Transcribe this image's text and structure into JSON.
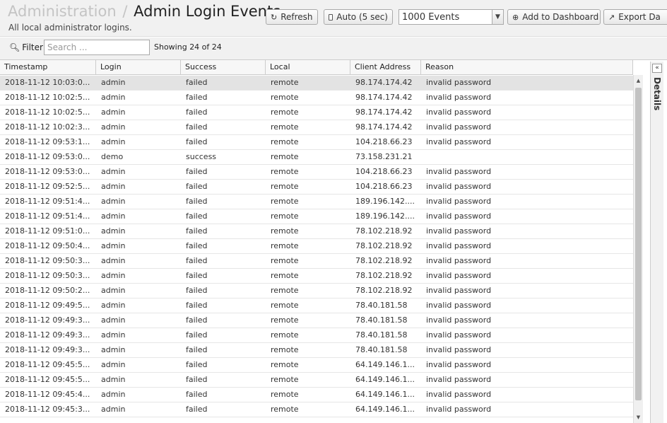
{
  "header": {
    "breadcrumb_parent": "Administration",
    "separator": "/",
    "title": "Admin Login Events",
    "subtitle": "All local administrator logins."
  },
  "toolbar": {
    "refresh_label": "Refresh",
    "auto_label": "Auto (5 sec)",
    "events_selected": "1000 Events",
    "add_dashboard_label": "Add to Dashboard",
    "export_label": "Export Da"
  },
  "filter": {
    "label": "Filter",
    "placeholder": "Search ...",
    "showing": "Showing 24 of 24"
  },
  "table": {
    "columns": [
      "Timestamp",
      "Login",
      "Success",
      "Local",
      "Client Address",
      "Reason"
    ],
    "rows": [
      [
        "2018-11-12 10:03:0...",
        "admin",
        "failed",
        "remote",
        "98.174.174.42",
        "invalid password"
      ],
      [
        "2018-11-12 10:02:5...",
        "admin",
        "failed",
        "remote",
        "98.174.174.42",
        "invalid password"
      ],
      [
        "2018-11-12 10:02:5...",
        "admin",
        "failed",
        "remote",
        "98.174.174.42",
        "invalid password"
      ],
      [
        "2018-11-12 10:02:3...",
        "admin",
        "failed",
        "remote",
        "98.174.174.42",
        "invalid password"
      ],
      [
        "2018-11-12 09:53:1...",
        "admin",
        "failed",
        "remote",
        "104.218.66.23",
        "invalid password"
      ],
      [
        "2018-11-12 09:53:0...",
        "demo",
        "success",
        "remote",
        "73.158.231.21",
        ""
      ],
      [
        "2018-11-12 09:53:0...",
        "admin",
        "failed",
        "remote",
        "104.218.66.23",
        "invalid password"
      ],
      [
        "2018-11-12 09:52:5...",
        "admin",
        "failed",
        "remote",
        "104.218.66.23",
        "invalid password"
      ],
      [
        "2018-11-12 09:51:4...",
        "admin",
        "failed",
        "remote",
        "189.196.142....",
        "invalid password"
      ],
      [
        "2018-11-12 09:51:4...",
        "admin",
        "failed",
        "remote",
        "189.196.142....",
        "invalid password"
      ],
      [
        "2018-11-12 09:51:0...",
        "admin",
        "failed",
        "remote",
        "78.102.218.92",
        "invalid password"
      ],
      [
        "2018-11-12 09:50:4...",
        "admin",
        "failed",
        "remote",
        "78.102.218.92",
        "invalid password"
      ],
      [
        "2018-11-12 09:50:3...",
        "admin",
        "failed",
        "remote",
        "78.102.218.92",
        "invalid password"
      ],
      [
        "2018-11-12 09:50:3...",
        "admin",
        "failed",
        "remote",
        "78.102.218.92",
        "invalid password"
      ],
      [
        "2018-11-12 09:50:2...",
        "admin",
        "failed",
        "remote",
        "78.102.218.92",
        "invalid password"
      ],
      [
        "2018-11-12 09:49:5...",
        "admin",
        "failed",
        "remote",
        "78.40.181.58",
        "invalid password"
      ],
      [
        "2018-11-12 09:49:3...",
        "admin",
        "failed",
        "remote",
        "78.40.181.58",
        "invalid password"
      ],
      [
        "2018-11-12 09:49:3...",
        "admin",
        "failed",
        "remote",
        "78.40.181.58",
        "invalid password"
      ],
      [
        "2018-11-12 09:49:3...",
        "admin",
        "failed",
        "remote",
        "78.40.181.58",
        "invalid password"
      ],
      [
        "2018-11-12 09:45:5...",
        "admin",
        "failed",
        "remote",
        "64.149.146.1...",
        "invalid password"
      ],
      [
        "2018-11-12 09:45:5...",
        "admin",
        "failed",
        "remote",
        "64.149.146.1...",
        "invalid password"
      ],
      [
        "2018-11-12 09:45:4...",
        "admin",
        "failed",
        "remote",
        "64.149.146.1...",
        "invalid password"
      ],
      [
        "2018-11-12 09:45:3...",
        "admin",
        "failed",
        "remote",
        "64.149.146.1...",
        "invalid password"
      ]
    ],
    "selected_row": 0
  },
  "details": {
    "label": "Details"
  },
  "icons": {
    "refresh": "refresh-icon",
    "search": "search-icon",
    "add": "plus-circle-icon",
    "export": "export-icon",
    "collapse": "double-chevron-left-icon"
  }
}
